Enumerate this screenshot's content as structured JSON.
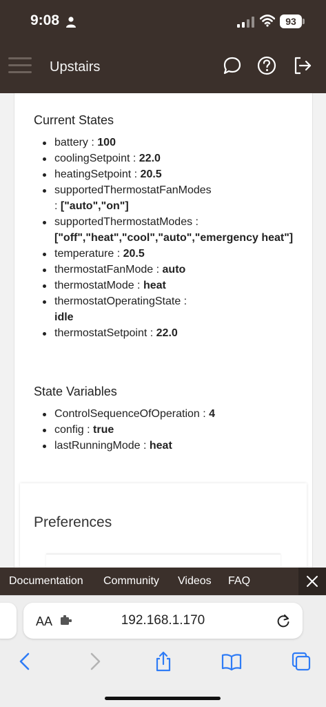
{
  "status_bar": {
    "time": "9:08",
    "battery_level": "93"
  },
  "header": {
    "title": "Upstairs",
    "icons": [
      "menu-icon",
      "chat-icon",
      "help-icon",
      "logout-icon"
    ]
  },
  "current_states": {
    "title": "Current States",
    "items": [
      {
        "key": "battery",
        "value": "100"
      },
      {
        "key": "coolingSetpoint",
        "value": "22.0"
      },
      {
        "key": "heatingSetpoint",
        "value": "20.5"
      },
      {
        "key": "supportedThermostatFanModes",
        "value": "[\"auto\",\"on\"]"
      },
      {
        "key": "supportedThermostatModes",
        "value": "[\"off\",\"heat\",\"cool\",\"auto\",\"emergency heat\"]"
      },
      {
        "key": "temperature",
        "value": "20.5"
      },
      {
        "key": "thermostatFanMode",
        "value": "auto"
      },
      {
        "key": "thermostatMode",
        "value": "heat"
      },
      {
        "key": "thermostatOperatingState",
        "value": "idle"
      },
      {
        "key": "thermostatSetpoint",
        "value": "22.0"
      }
    ]
  },
  "state_variables": {
    "title": "State Variables",
    "items": [
      {
        "key": "ControlSequenceOfOperation",
        "value": "4"
      },
      {
        "key": "config",
        "value": "true"
      },
      {
        "key": "lastRunningMode",
        "value": "heat"
      }
    ]
  },
  "preferences": {
    "title": "Preferences"
  },
  "footer": {
    "links": [
      "Documentation",
      "Community",
      "Videos",
      "FAQ"
    ]
  },
  "browser": {
    "aa_label": "AA",
    "url": "192.168.1.170"
  },
  "colors": {
    "header_bg": "#3b302b",
    "ios_blue": "#2f7cf6"
  }
}
